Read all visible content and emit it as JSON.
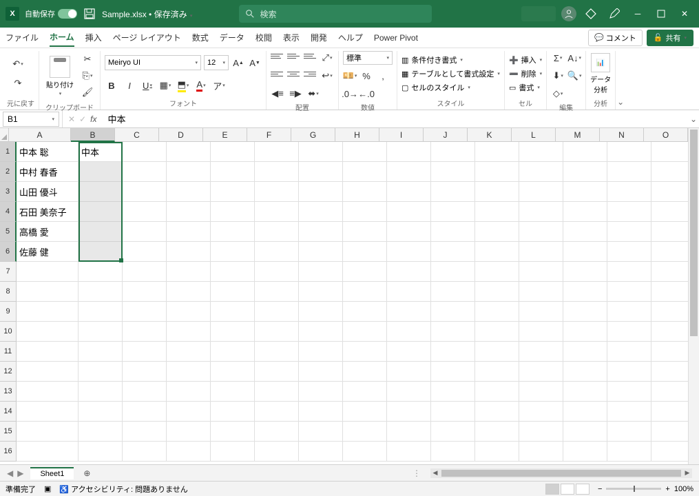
{
  "titlebar": {
    "autosave_label": "自動保存",
    "autosave_state": "オン",
    "filename": "Sample.xlsx",
    "saved_status": "保存済み",
    "search_placeholder": "検索"
  },
  "tabs": {
    "items": [
      "ファイル",
      "ホーム",
      "挿入",
      "ページ レイアウト",
      "数式",
      "データ",
      "校閲",
      "表示",
      "開発",
      "ヘルプ",
      "Power Pivot"
    ],
    "active_index": 1,
    "comment_label": "コメント",
    "share_label": "共有"
  },
  "ribbon": {
    "undo_group": "元に戻す",
    "clipboard_group": "クリップボード",
    "paste_label": "貼り付け",
    "font_group": "フォント",
    "font_name": "Meiryo UI",
    "font_size": "12",
    "align_group": "配置",
    "number_group": "数値",
    "number_format": "標準",
    "style_group": "スタイル",
    "cond_fmt": "条件付き書式",
    "table_fmt": "テーブルとして書式設定",
    "cell_style": "セルのスタイル",
    "cells_group": "セル",
    "insert_label": "挿入",
    "delete_label": "削除",
    "format_label": "書式",
    "edit_group": "編集",
    "analysis_group": "分析",
    "analysis_label": "データ\n分析"
  },
  "formula_bar": {
    "name_box": "B1",
    "formula": "中本"
  },
  "grid": {
    "columns": [
      "A",
      "B",
      "C",
      "D",
      "E",
      "F",
      "G",
      "H",
      "I",
      "J",
      "K",
      "L",
      "M",
      "N",
      "O"
    ],
    "row_count": 16,
    "col_a": [
      "中本  聡",
      "中村  春香",
      "山田  優斗",
      "石田  美奈子",
      "高橋  愛",
      "佐藤  健"
    ],
    "col_b": [
      "中本"
    ],
    "selected_range": "B1:B6",
    "active_cell": "B1"
  },
  "sheet_tabs": {
    "active": "Sheet1"
  },
  "statusbar": {
    "ready": "準備完了",
    "accessibility": "アクセシビリティ: 問題ありません",
    "zoom": "100%"
  }
}
